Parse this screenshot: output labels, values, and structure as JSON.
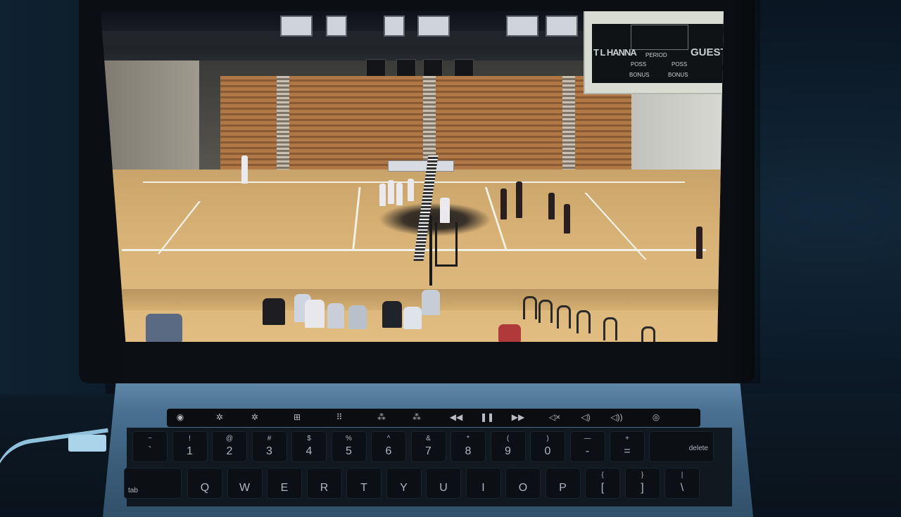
{
  "scoreboard": {
    "home": "T L HANNA",
    "guest": "GUEST",
    "period": "PERIOD",
    "home_poss": "POSS",
    "guest_poss": "POSS",
    "home_bonus": "BONUS",
    "guest_bonus": "BONUS"
  },
  "touch_bar": {
    "icons": [
      "esc-icon",
      "brightness-down-icon",
      "brightness-up-icon",
      "mission-control-icon",
      "launchpad-icon",
      "keyboard-light-down-icon",
      "keyboard-light-up-icon",
      "rewind-icon",
      "play-pause-icon",
      "fast-forward-icon",
      "mute-icon",
      "volume-down-icon",
      "volume-up-icon",
      "siri-icon"
    ],
    "glyphs": [
      "◉",
      "✲",
      "✲",
      "⊞",
      "⠿",
      "⁂",
      "⁂",
      "◀◀",
      "❚❚",
      "▶▶",
      "◁×",
      "◁)",
      "◁))",
      "◎"
    ]
  },
  "keyboard": {
    "number_row": [
      {
        "top": "~",
        "main": "`"
      },
      {
        "top": "!",
        "main": "1"
      },
      {
        "top": "@",
        "main": "2"
      },
      {
        "top": "#",
        "main": "3"
      },
      {
        "top": "$",
        "main": "4"
      },
      {
        "top": "%",
        "main": "5"
      },
      {
        "top": "^",
        "main": "6"
      },
      {
        "top": "&",
        "main": "7"
      },
      {
        "top": "*",
        "main": "8"
      },
      {
        "top": "(",
        "main": "9"
      },
      {
        "top": ")",
        "main": "0"
      },
      {
        "top": "—",
        "main": "-"
      },
      {
        "top": "+",
        "main": "="
      }
    ],
    "delete": "delete",
    "tab": "tab",
    "letter_row": [
      {
        "main": "Q"
      },
      {
        "main": "W"
      },
      {
        "main": "E"
      },
      {
        "main": "R"
      },
      {
        "main": "T"
      },
      {
        "main": "Y"
      },
      {
        "main": "U"
      },
      {
        "main": "I"
      },
      {
        "main": "O"
      },
      {
        "main": "P"
      },
      {
        "top": "{",
        "main": "["
      },
      {
        "top": "}",
        "main": "]"
      },
      {
        "top": "|",
        "main": "\\"
      }
    ]
  }
}
